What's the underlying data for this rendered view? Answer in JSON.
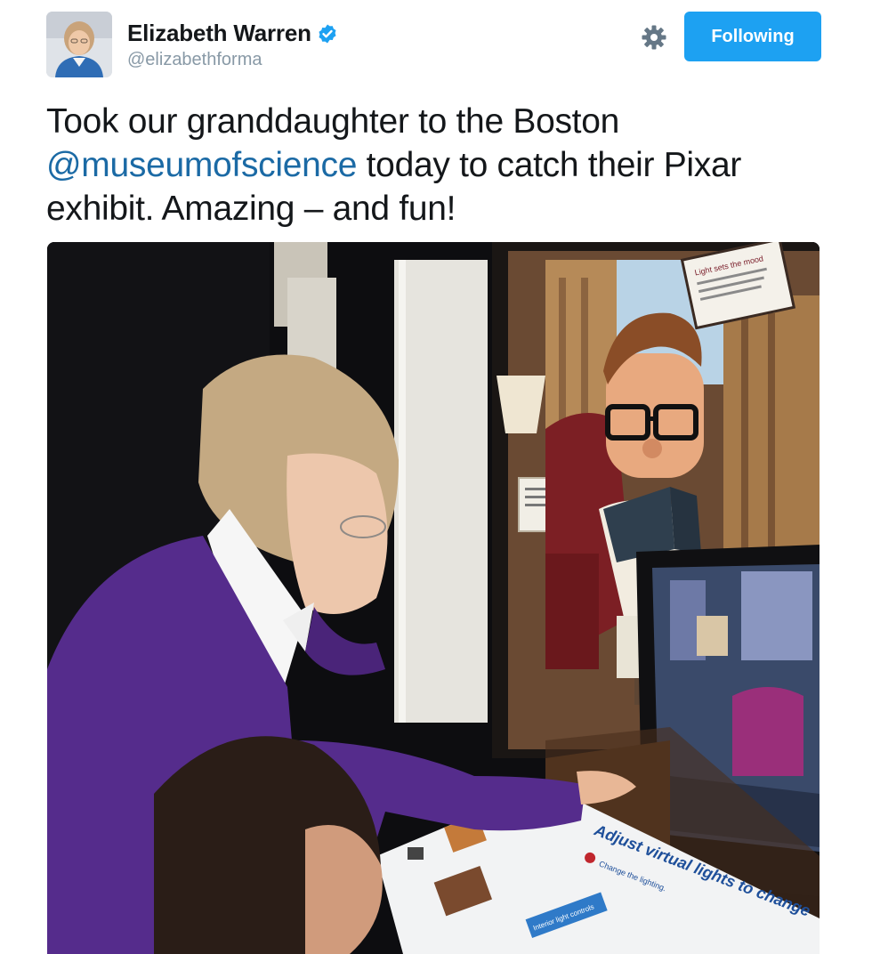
{
  "tweet": {
    "author": {
      "display_name": "Elizabeth Warren",
      "handle": "@elizabethforma",
      "verified": true,
      "verified_icon": "verified-badge-icon"
    },
    "actions": {
      "settings_icon": "gear-icon",
      "follow_label": "Following"
    },
    "text": {
      "line1": "Took our granddaughter to the Boston",
      "mention": "@museumofscience",
      "rest": " today to catch their Pixar exhibit. Amazing – and fun!"
    },
    "media": {
      "kind": "photo",
      "exhibit_sign": "Light sets the mood",
      "panel_heading": "Adjust virtual lights to change",
      "panel_step": "Change the lighting.",
      "panel_button": "Interior light controls"
    }
  },
  "colors": {
    "accent": "#1da1f2",
    "link": "#1b6aa5",
    "text": "#14171a",
    "muted": "#8899a6"
  }
}
